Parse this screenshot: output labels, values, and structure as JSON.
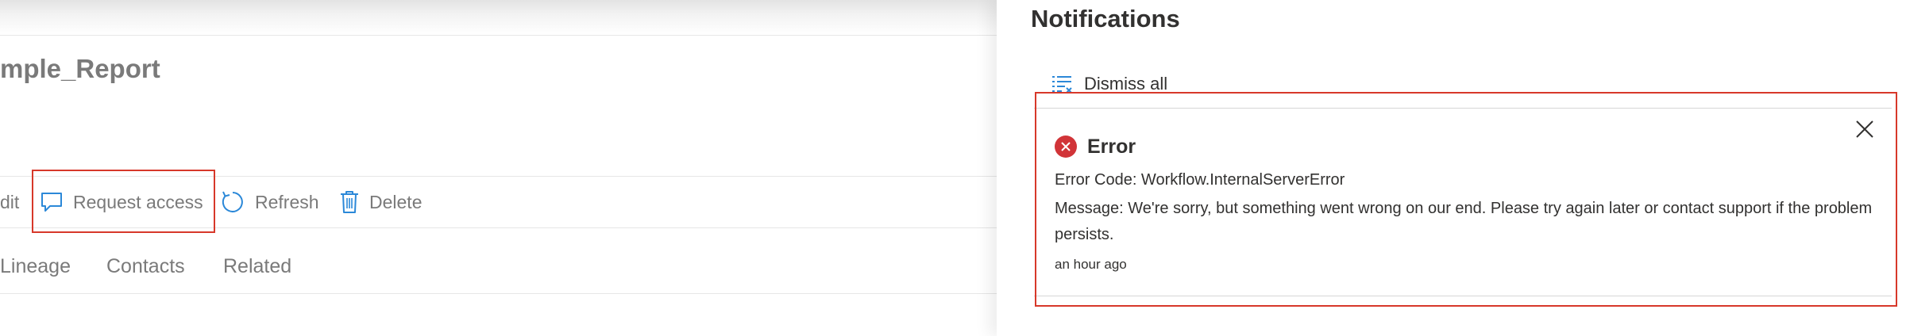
{
  "page": {
    "title": "mple_Report",
    "toolbar": {
      "edit_label": "dit",
      "request_access_label": "Request access",
      "refresh_label": "Refresh",
      "delete_label": "Delete"
    },
    "tabs": [
      "Lineage",
      "Contacts",
      "Related"
    ]
  },
  "notifications": {
    "title": "Notifications",
    "dismiss_all_label": "Dismiss all",
    "items": [
      {
        "type": "Error",
        "code_line": "Error Code: Workflow.InternalServerError",
        "message": "Message: We're sorry, but something went wrong on our end. Please try again later or contact support if the problem persists.",
        "time": "an hour ago"
      }
    ]
  },
  "colors": {
    "highlight_outline": "#d7382a",
    "error_icon": "#d13438",
    "icon_blue": "#2b88d8"
  }
}
